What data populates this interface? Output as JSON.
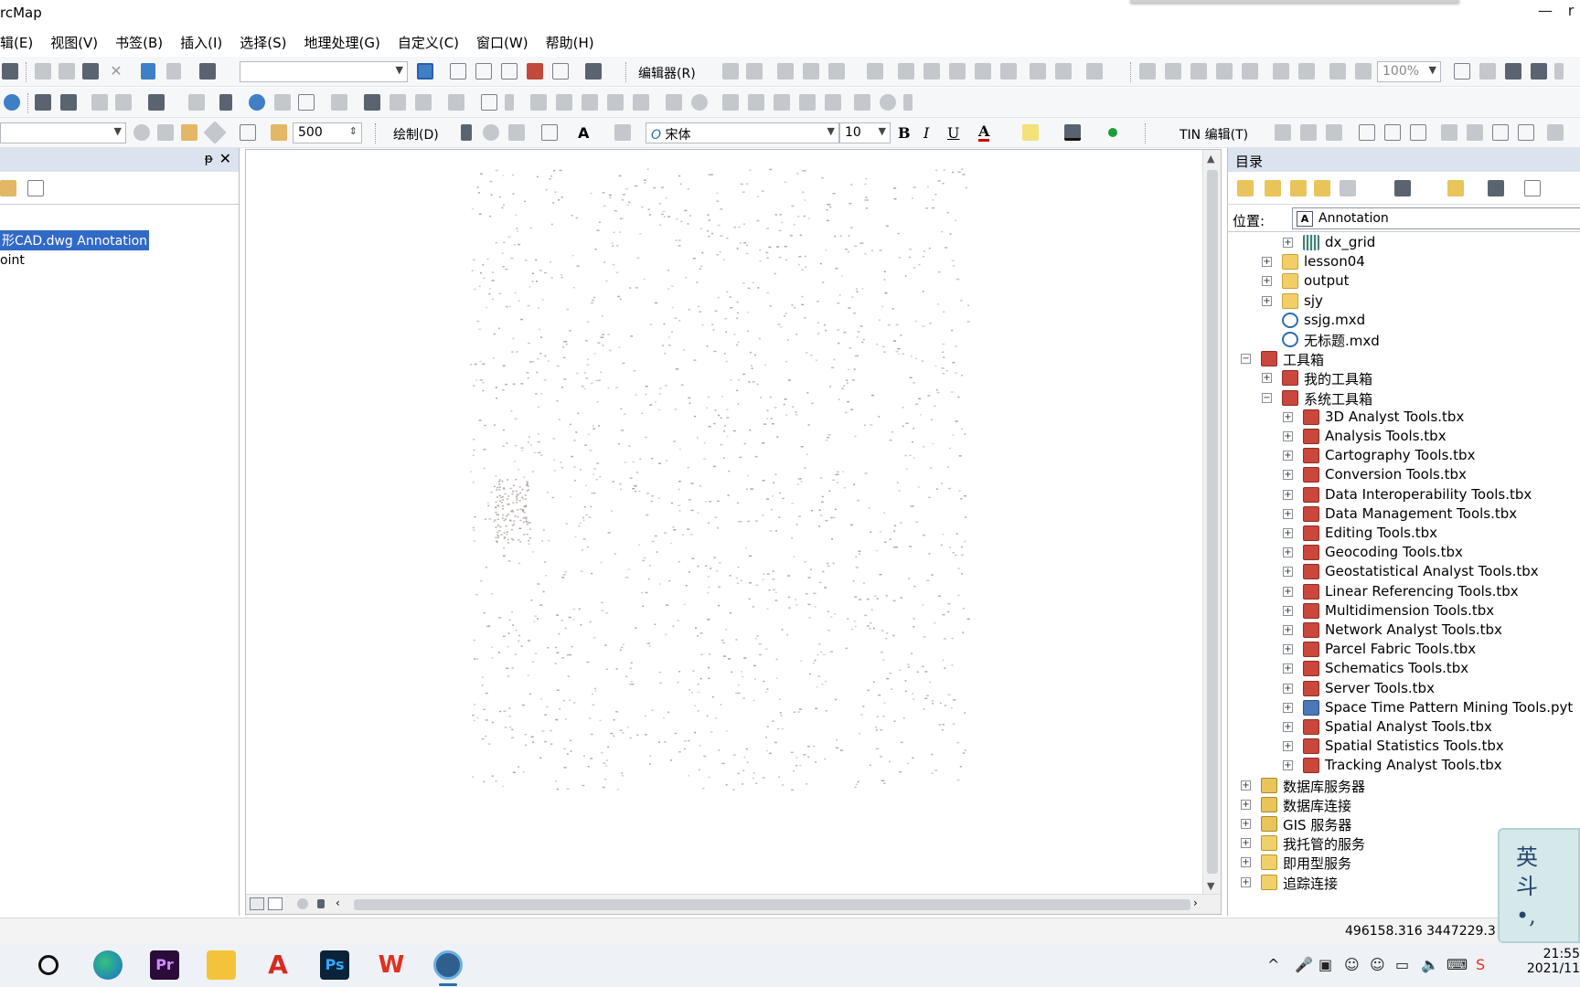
{
  "app": {
    "title": "ArcMap",
    "title_visible": "rcMap"
  },
  "window_controls": {
    "minimize": "—",
    "restore": "r"
  },
  "menu": {
    "items": [
      "编辑(E)",
      "视图(V)",
      "书签(B)",
      "插入(I)",
      "选择(S)",
      "地理处理(G)",
      "自定义(C)",
      "窗口(W)",
      "帮助(H)"
    ],
    "items_visible": [
      "辑(E)",
      "视图(V)",
      "书签(B)",
      "插入(I)",
      "选择(S)",
      "地理处理(G)",
      "自定义(C)",
      "窗口(W)",
      "帮助(H)"
    ]
  },
  "toolbar_standard": {
    "scale_combo": "",
    "editor_label": "编辑器(R)",
    "zoom_combo": "100%"
  },
  "toolbar_draw": {
    "layer_combo": "",
    "value_input": "500",
    "draw_label": "绘制(D)",
    "font_combo": "宋体",
    "font_size": "10",
    "bold": "B",
    "italic": "I",
    "underline": "U",
    "font_color": "A",
    "tin_editor_label": "TIN 编辑(T)"
  },
  "toc": {
    "items": [
      {
        "label": "形CAD.dwg Annotation",
        "selected": true
      },
      {
        "label": "oint",
        "selected": false
      }
    ],
    "pin_icon": "pin-icon",
    "close_icon": "close-icon"
  },
  "catalog": {
    "title": "目录",
    "location_label": "位置:",
    "location_value": "Annotation",
    "location_badge": "A",
    "tree": [
      {
        "label": "dx_grid",
        "icon": "grid-icon",
        "expand": "+"
      },
      {
        "label": "lesson04",
        "icon": "folder-icon",
        "expand": "+"
      },
      {
        "label": "output",
        "icon": "folder-icon",
        "expand": "+"
      },
      {
        "label": "sjy",
        "icon": "folder-icon",
        "expand": "+"
      },
      {
        "label": "ssjg.mxd",
        "icon": "mxd-icon",
        "expand": ""
      },
      {
        "label": "无标题.mxd",
        "icon": "mxd-icon",
        "expand": ""
      },
      {
        "label": "工具箱",
        "icon": "toolbox-icon",
        "expand": "−"
      },
      {
        "label": "我的工具箱",
        "icon": "toolbox-icon",
        "expand": "+"
      },
      {
        "label": "系统工具箱",
        "icon": "toolbox-icon",
        "expand": "−"
      },
      {
        "label": "3D Analyst Tools.tbx",
        "icon": "toolbox-icon",
        "expand": "+"
      },
      {
        "label": "Analysis Tools.tbx",
        "icon": "toolbox-icon",
        "expand": "+"
      },
      {
        "label": "Cartography Tools.tbx",
        "icon": "toolbox-icon",
        "expand": "+"
      },
      {
        "label": "Conversion Tools.tbx",
        "icon": "toolbox-icon",
        "expand": "+"
      },
      {
        "label": "Data Interoperability Tools.tbx",
        "icon": "toolbox-icon",
        "expand": "+"
      },
      {
        "label": "Data Management Tools.tbx",
        "icon": "toolbox-icon",
        "expand": "+"
      },
      {
        "label": "Editing Tools.tbx",
        "icon": "toolbox-icon",
        "expand": "+"
      },
      {
        "label": "Geocoding Tools.tbx",
        "icon": "toolbox-icon",
        "expand": "+"
      },
      {
        "label": "Geostatistical Analyst Tools.tbx",
        "icon": "toolbox-icon",
        "expand": "+"
      },
      {
        "label": "Linear Referencing Tools.tbx",
        "icon": "toolbox-icon",
        "expand": "+"
      },
      {
        "label": "Multidimension Tools.tbx",
        "icon": "toolbox-icon",
        "expand": "+"
      },
      {
        "label": "Network Analyst Tools.tbx",
        "icon": "toolbox-icon",
        "expand": "+"
      },
      {
        "label": "Parcel Fabric Tools.tbx",
        "icon": "toolbox-icon",
        "expand": "+"
      },
      {
        "label": "Schematics Tools.tbx",
        "icon": "toolbox-icon",
        "expand": "+"
      },
      {
        "label": "Server Tools.tbx",
        "icon": "toolbox-icon",
        "expand": "+"
      },
      {
        "label": "Space Time Pattern Mining Tools.pyt",
        "icon": "python-toolbox-icon",
        "expand": "+"
      },
      {
        "label": "Spatial Analyst Tools.tbx",
        "icon": "toolbox-icon",
        "expand": "+"
      },
      {
        "label": "Spatial Statistics Tools.tbx",
        "icon": "toolbox-icon",
        "expand": "+"
      },
      {
        "label": "Tracking Analyst Tools.tbx",
        "icon": "toolbox-icon",
        "expand": "+"
      },
      {
        "label": "数据库服务器",
        "icon": "database-server-icon",
        "expand": "+"
      },
      {
        "label": "数据库连接",
        "icon": "database-connection-icon",
        "expand": "+"
      },
      {
        "label": "GIS 服务器",
        "icon": "gis-server-icon",
        "expand": "+"
      },
      {
        "label": "我托管的服务",
        "icon": "hosted-services-icon",
        "expand": "+"
      },
      {
        "label": "即用型服务",
        "icon": "ready-services-icon",
        "expand": "+"
      },
      {
        "label": "追踪连接",
        "icon": "tracking-connection-icon",
        "expand": "+"
      }
    ]
  },
  "status": {
    "coordinates": "496158.316  3447229.3"
  },
  "note_widget": {
    "text": "英 斗 •,"
  },
  "taskbar": {
    "apps": [
      "search-icon",
      "edge-icon",
      "premiere-icon",
      "file-explorer-icon",
      "acrobat-icon",
      "photoshop-icon",
      "wps-icon",
      "arcmap-icon"
    ],
    "pr_label": "Pr",
    "ps_label": "Ps",
    "acro_label": "A",
    "wps_label": "W",
    "clock_time": "21:55",
    "clock_date": "2021/11"
  },
  "colors": {
    "selection": "#3169c6",
    "panel_header": "#dbe3ee",
    "toolbar_bg": "#f6f7f9",
    "map_points": "#9a8f8a"
  }
}
